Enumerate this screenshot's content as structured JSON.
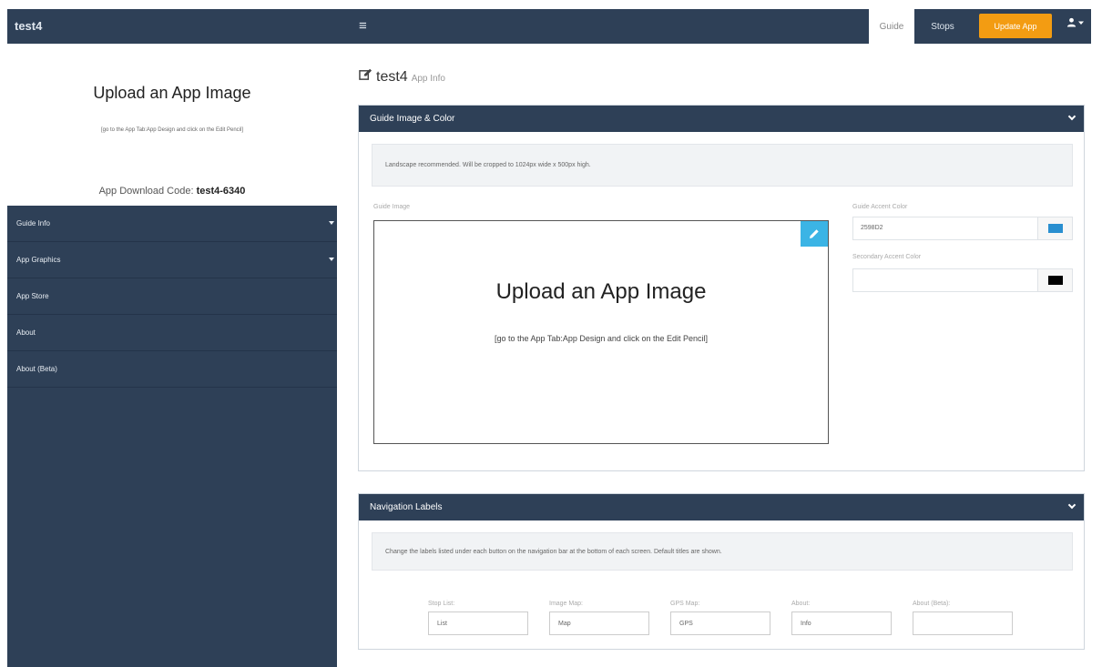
{
  "navbar": {
    "brand": "test4",
    "menu_icon": "hamburger-icon",
    "tabs": [
      "Guide",
      "Stops"
    ],
    "update_label": "Update App",
    "user_icon": "user-icon"
  },
  "sidebar": {
    "upload_title": "Upload an App Image",
    "upload_hint": "[go to the App Tab:App Design and click on the Edit Pencil]",
    "code_label": "App Download Code:",
    "code_value": "test4-6340",
    "items": [
      "Guide Info",
      "App Graphics",
      "App Store",
      "About",
      "About (Beta)"
    ]
  },
  "page": {
    "title": "test4",
    "subtitle": "App Info",
    "title_icon": "edit-icon"
  },
  "guide_image_panel": {
    "heading": "Guide Image & Color",
    "note": "Landscape recommended. Will be cropped to 1024px wide x 500px high.",
    "image_label": "Guide Image",
    "image_title": "Upload an App Image",
    "image_hint": "[go to the App Tab:App Design and click on the Edit Pencil]",
    "accent_label": "Guide Accent Color",
    "accent_value": "2598D2",
    "accent_color": "#2a8fd0",
    "secondary_label": "Secondary Accent Color",
    "secondary_value": "",
    "secondary_color": "#000000"
  },
  "nav_labels_panel": {
    "heading": "Navigation Labels",
    "note": "Change the labels listed under each button on the navigation bar at the bottom of each screen. Default titles are shown.",
    "fields": [
      {
        "label": "Stop List:",
        "value": "List"
      },
      {
        "label": "Image Map:",
        "value": "Map"
      },
      {
        "label": "GPS Map:",
        "value": "GPS"
      },
      {
        "label": "About:",
        "value": "Info"
      },
      {
        "label": "About (Beta):",
        "value": ""
      }
    ]
  },
  "colors": {
    "navy": "#2e4057",
    "orange": "#f39c12",
    "pencil_blue": "#3bb4e5"
  }
}
